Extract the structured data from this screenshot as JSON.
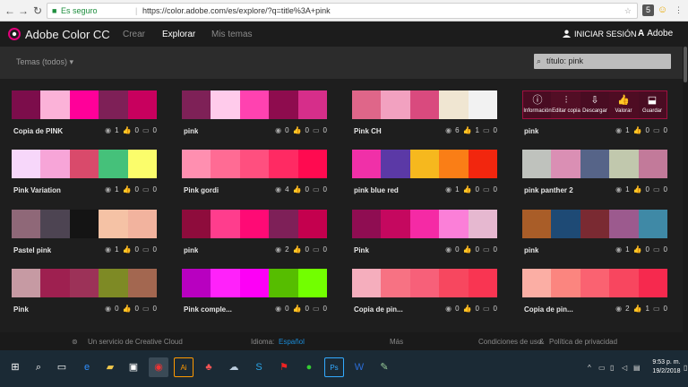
{
  "browser": {
    "secure_label": "Es seguro",
    "url": "https://color.adobe.com/es/explore/?q=title%3A+pink",
    "ext1": "5"
  },
  "app": {
    "brand": "Adobe Color CC",
    "nav": [
      "Crear",
      "Explorar",
      "Mis temas"
    ],
    "active_nav": "Explorar",
    "login": "INICIAR SESIÓN",
    "adobe": "Adobe",
    "filter": "Temas (todos)",
    "search_value": "título: pink"
  },
  "hover_actions": [
    "Información",
    "Editar copia",
    "Descargar",
    "Valorar",
    "Guardar"
  ],
  "themes": [
    {
      "name": "Copia de PINK",
      "views": "1",
      "likes": "0",
      "comments": "0",
      "colors": [
        "#7c0d4b",
        "#fbb2d8",
        "#ff0099",
        "#7e2057",
        "#c8005e"
      ]
    },
    {
      "name": "pink",
      "views": "0",
      "likes": "0",
      "comments": "0",
      "colors": [
        "#7e2157",
        "#ffcbeb",
        "#ff42b0",
        "#8e0c4e",
        "#d62e8a"
      ]
    },
    {
      "name": "Pink CH",
      "views": "6",
      "likes": "1",
      "comments": "0",
      "colors": [
        "#df6689",
        "#f2a1c0",
        "#d94a7e",
        "#f0e6d2",
        "#f2f2f2"
      ]
    },
    {
      "name": "pink",
      "views": "1",
      "likes": "0",
      "comments": "0",
      "colors": [
        "#8a1340",
        "#b01e4f",
        "#8a1340",
        "#a01545",
        "#8a1340"
      ]
    },
    {
      "name": "Pink Variation",
      "views": "1",
      "likes": "0",
      "comments": "0",
      "colors": [
        "#f7d7fa",
        "#f7a5d8",
        "#d94a6b",
        "#45c17a",
        "#fbfd6b"
      ]
    },
    {
      "name": "Pink gordi",
      "views": "4",
      "likes": "0",
      "comments": "0",
      "colors": [
        "#ff8fb0",
        "#ff6b94",
        "#ff4f7f",
        "#ff2a63",
        "#ff0a50"
      ]
    },
    {
      "name": "pink blue red",
      "views": "1",
      "likes": "0",
      "comments": "0",
      "colors": [
        "#f030a8",
        "#5b39a6",
        "#f6b81e",
        "#fa7e16",
        "#f2260e"
      ]
    },
    {
      "name": "pink panther 2",
      "views": "1",
      "likes": "0",
      "comments": "0",
      "colors": [
        "#bfc2bd",
        "#da8fb4",
        "#566488",
        "#c1c8ad",
        "#c27a9a"
      ]
    },
    {
      "name": "Pastel pink",
      "views": "1",
      "likes": "0",
      "comments": "0",
      "colors": [
        "#8f6878",
        "#4d4452",
        "#141414",
        "#f5c2a5",
        "#f2b39e"
      ]
    },
    {
      "name": "pink",
      "views": "2",
      "likes": "0",
      "comments": "0",
      "colors": [
        "#8e0c3c",
        "#ff3d8d",
        "#ff0a75",
        "#7e2058",
        "#c4004e"
      ]
    },
    {
      "name": "Pink",
      "views": "0",
      "likes": "0",
      "comments": "0",
      "colors": [
        "#8f0d52",
        "#c5085f",
        "#f52aa5",
        "#fb7fd8",
        "#e6b8d0"
      ]
    },
    {
      "name": "pink",
      "views": "1",
      "likes": "0",
      "comments": "0",
      "colors": [
        "#a95d28",
        "#1e4a75",
        "#7a2a32",
        "#9c5a8e",
        "#3f89a6"
      ]
    },
    {
      "name": "Pink",
      "views": "0",
      "likes": "0",
      "comments": "0",
      "colors": [
        "#c69aa3",
        "#9e2050",
        "#9c3258",
        "#7e8a25",
        "#a36750"
      ]
    },
    {
      "name": "Pink comple...",
      "views": "0",
      "likes": "0",
      "comments": "0",
      "colors": [
        "#b800c0",
        "#ff22fa",
        "#fd00f6",
        "#56bd00",
        "#72ff00"
      ]
    },
    {
      "name": "Copia de pin...",
      "views": "0",
      "likes": "0",
      "comments": "0",
      "colors": [
        "#f5aebd",
        "#f77283",
        "#f76079",
        "#f7475f",
        "#f93552"
      ]
    },
    {
      "name": "Copia de pin...",
      "views": "2",
      "likes": "1",
      "comments": "0",
      "colors": [
        "#fbaea4",
        "#fb857f",
        "#fa6271",
        "#f8465f",
        "#f6294e"
      ]
    }
  ],
  "footer": {
    "cc": "Un servicio de Creative Cloud",
    "lang_label": "Idioma:",
    "lang_value": "Español",
    "more": "Más",
    "terms": "Condiciones de uso",
    "privacy": "Política de privacidad"
  },
  "taskbar": {
    "time": "9:53 p. m.",
    "date": "19/2/2018"
  }
}
